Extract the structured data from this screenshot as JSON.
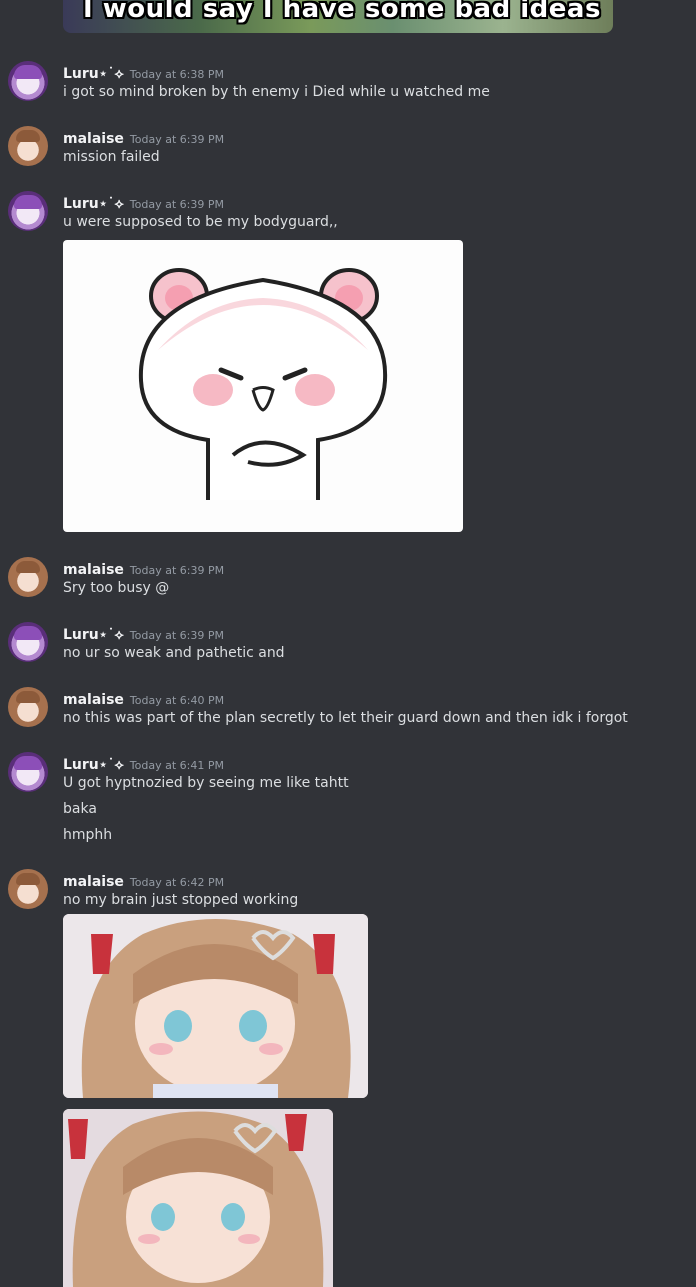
{
  "top_gif_caption": "I would say I have some bad ideas",
  "messages": [
    {
      "user": "Luru⋆˙⟡",
      "time": "Today at 6:38 PM",
      "lines": [
        "i got so mind broken by th enemy i Died while u watched me"
      ]
    },
    {
      "user": "malaise",
      "time": "Today at 6:39 PM",
      "lines": [
        "mission failed"
      ]
    },
    {
      "user": "Luru⋆˙⟡",
      "time": "Today at 6:39 PM",
      "lines": [
        "u were supposed to be my bodyguard,,"
      ]
    },
    {
      "user": "malaise",
      "time": "Today at 6:39 PM",
      "lines": [
        "Sry too busy @"
      ]
    },
    {
      "user": "Luru⋆˙⟡",
      "time": "Today at 6:39 PM",
      "lines": [
        "no ur so weak and pathetic and"
      ]
    },
    {
      "user": "malaise",
      "time": "Today at 6:40 PM",
      "lines": [
        "no this was part of the plan secretly to let their guard down and then idk i forgot"
      ]
    },
    {
      "user": "Luru⋆˙⟡",
      "time": "Today at 6:41 PM",
      "lines": [
        "U got hyptnozied by seeing me like tahtt",
        "baka",
        "hmphh"
      ]
    },
    {
      "user": "malaise",
      "time": "Today at 6:42 PM",
      "lines": [
        "no my brain just stopped working"
      ]
    }
  ]
}
